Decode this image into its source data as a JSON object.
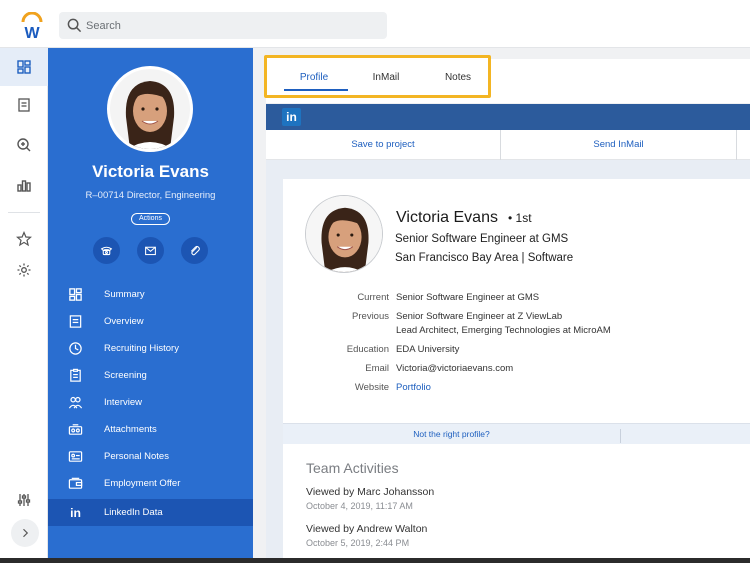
{
  "search": {
    "placeholder": "Search"
  },
  "candidate": {
    "name": "Victoria Evans",
    "subtitle": "R–00714 Director, Engineering",
    "actions_label": "Actions"
  },
  "sidebar": {
    "items": [
      {
        "label": "Summary",
        "icon": "grid-icon"
      },
      {
        "label": "Overview",
        "icon": "document-icon"
      },
      {
        "label": "Recruiting History",
        "icon": "clock-icon"
      },
      {
        "label": "Screening",
        "icon": "clipboard-icon"
      },
      {
        "label": "Interview",
        "icon": "people-icon"
      },
      {
        "label": "Attachments",
        "icon": "attachment-box-icon"
      },
      {
        "label": "Personal Notes",
        "icon": "note-card-icon"
      },
      {
        "label": "Employment Offer",
        "icon": "offer-icon"
      },
      {
        "label": "LinkedIn Data",
        "icon": "linkedin-icon"
      }
    ],
    "active_index": 8
  },
  "tabs": [
    {
      "label": "Profile",
      "active": true
    },
    {
      "label": "InMail",
      "active": false
    },
    {
      "label": "Notes",
      "active": false
    }
  ],
  "linkedin": {
    "logo_text": "in",
    "save_label": "Save to project",
    "inmail_label": "Send InMail"
  },
  "profile": {
    "name": "Victoria Evans",
    "degree": "• 1st",
    "headline": "Senior Software Engineer at GMS",
    "location": "San Francisco Bay Area | Software",
    "current_label": "Current",
    "current_value": "Senior Software Engineer at GMS",
    "previous_label": "Previous",
    "previous_value_1": "Senior Software Engineer at Z ViewLab",
    "previous_value_2": "Lead Architect, Emerging Technologies at MicroAM",
    "education_label": "Education",
    "education_value": "EDA University",
    "email_label": "Email",
    "email_value": "Victoria@victoriaevans.com",
    "website_label": "Website",
    "website_value": "Portfolio",
    "not_right_label": "Not the right profile?"
  },
  "team": {
    "title": "Team Activities",
    "activities": [
      {
        "text": "Viewed by Marc Johansson",
        "date": "October 4, 2019, 11:17 AM"
      },
      {
        "text": "Viewed by Andrew Walton",
        "date": "October 5, 2019, 2:44 PM"
      }
    ]
  },
  "colors": {
    "sidebar_blue": "#2a6ed0",
    "active_blue": "#1c55b3",
    "link_blue": "#1e5fbf",
    "highlight_yellow": "#f3b523",
    "linkedin_bar": "#2c5b9c"
  }
}
